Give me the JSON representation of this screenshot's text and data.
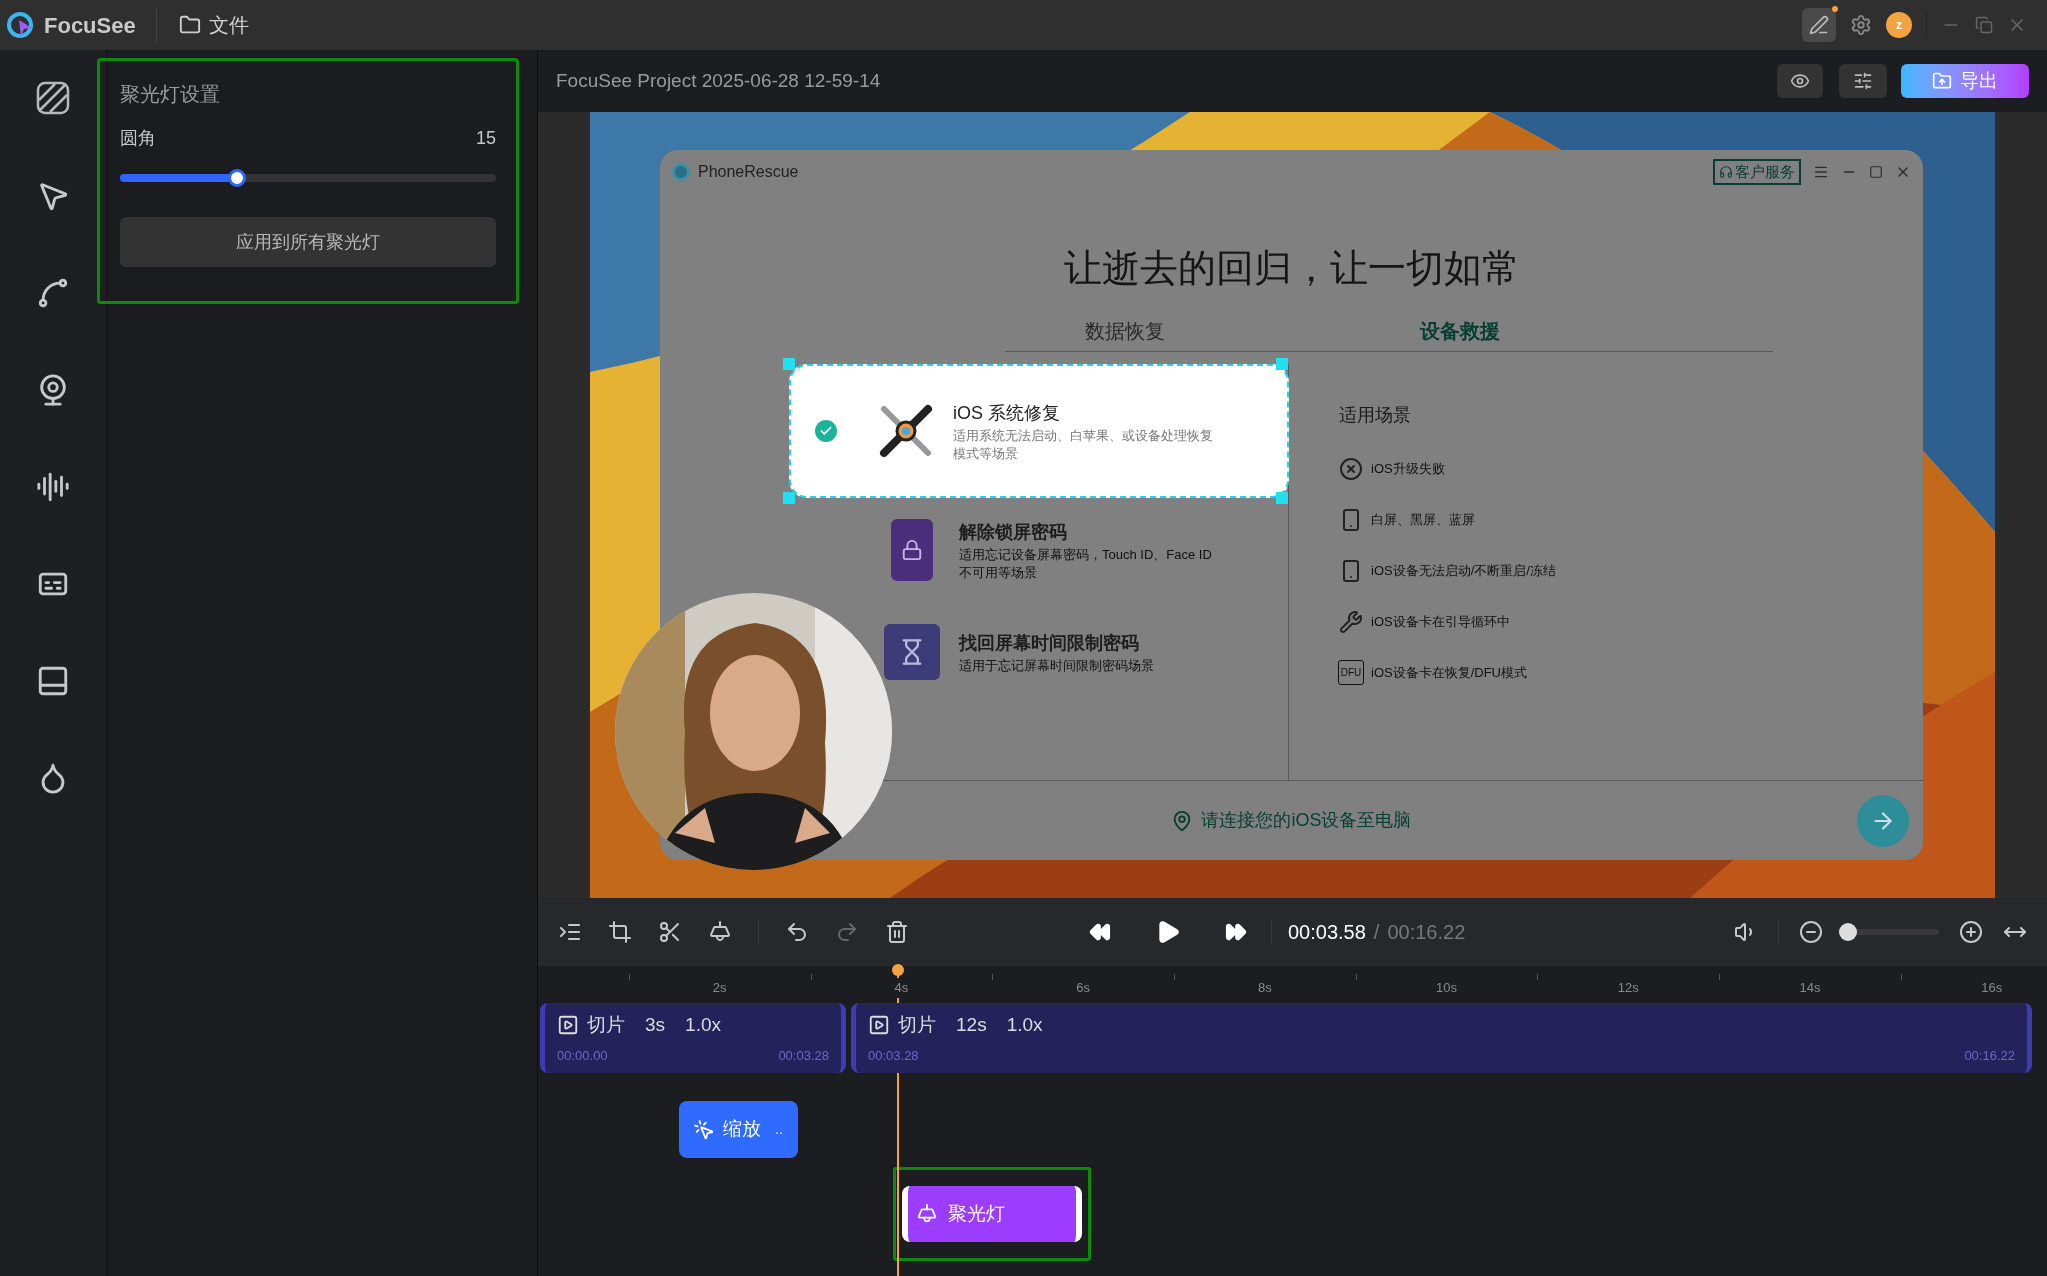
{
  "app": {
    "name": "FocuSee"
  },
  "menu": [
    {
      "label": "文件"
    }
  ],
  "avatar": {
    "letter": "z"
  },
  "settings_panel": {
    "title": "聚光灯设置",
    "slider": {
      "label": "圆角",
      "value": "15",
      "level": 0.31
    },
    "apply_button": "应用到所有聚光灯"
  },
  "project_title": "FocuSee Project 2025-06-28 12-59-14",
  "export_button": "导出",
  "preview": {
    "window": {
      "title": "PhoneRescue",
      "support_button": "客户服务",
      "headline": "让逝去的回归，让一切如常",
      "tabs": [
        {
          "label": "数据恢复",
          "selected": false
        },
        {
          "label": "设备救援",
          "selected": true
        }
      ],
      "options": [
        {
          "kind": "repair",
          "title": "iOS 系统修复",
          "description": "适用系统无法启动、白苹果、或设备处理恢复模式等场景",
          "spotlight": true
        },
        {
          "kind": "lock",
          "title": "解除锁屏密码",
          "description": "适用忘记设备屏幕密码，Touch ID、Face ID 不可用等场景",
          "spotlight": false
        },
        {
          "kind": "hourglass",
          "title": "找回屏幕时间限制密码",
          "description": "适用于忘记屏幕时间限制密码场景",
          "spotlight": false
        }
      ],
      "scenarios_title": "适用场景",
      "scenarios": [
        {
          "kind": "cross",
          "label": "iOS升级失败"
        },
        {
          "kind": "phone",
          "label": "白屏、黑屏、蓝屏"
        },
        {
          "kind": "phone",
          "label": "iOS设备无法启动/不断重启/冻结"
        },
        {
          "kind": "tools",
          "label": "iOS设备卡在引导循环中"
        },
        {
          "kind": "dfu",
          "label": "iOS设备卡在恢复/DFU模式",
          "icon_text": "DFU"
        }
      ],
      "connect_hint": "请连接您的iOS设备至电脑"
    }
  },
  "player": {
    "current": "00:03.58",
    "separator": "/",
    "total": "00:16.22",
    "zoom": {
      "level": 0.0
    }
  },
  "ruler": [
    "2s",
    "4s",
    "6s",
    "8s",
    "10s",
    "12s",
    "14s",
    "16s"
  ],
  "clips": [
    {
      "label": "切片",
      "duration": "3s",
      "speed": "1.0x",
      "start": "00:00.00",
      "end": "00:03.28"
    },
    {
      "label": "切片",
      "duration": "12s",
      "speed": "1.0x",
      "start": "00:03.28",
      "end": "00:16.22"
    }
  ],
  "zoom_clip": {
    "label": "缩放",
    "more": ".."
  },
  "spotlight_clip": {
    "label": "聚光灯",
    "selected": true
  }
}
